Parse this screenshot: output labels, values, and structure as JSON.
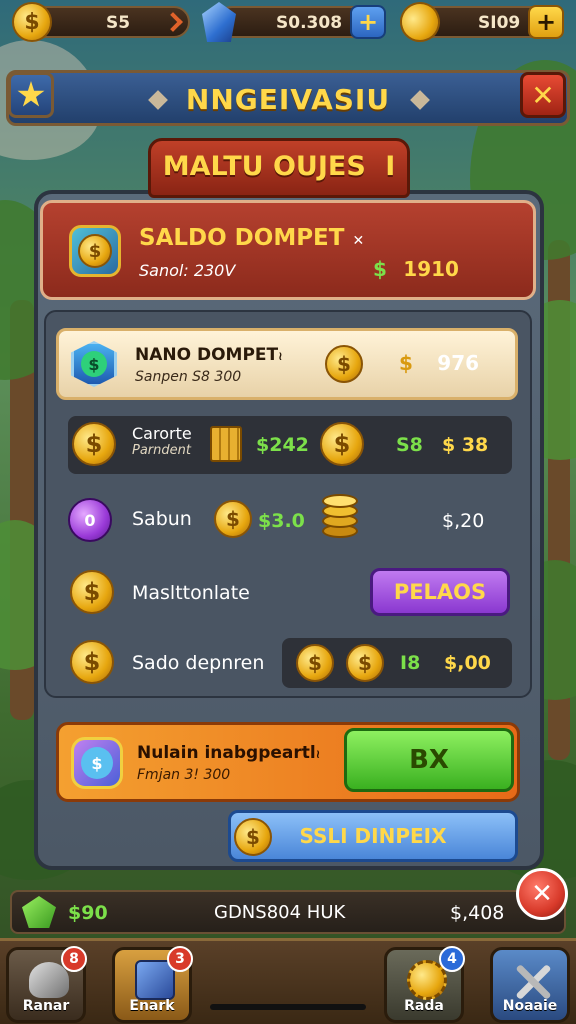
{
  "top_bar": {
    "coins_value": "S5",
    "gems_value": "S0.308",
    "gold_value": "SI09",
    "coin_glyph": "$",
    "plus_glyph": "+"
  },
  "title_banner": {
    "title": "NNGEIVASIU",
    "star_icon": "star-icon",
    "close_glyph": "✕"
  },
  "ribbon": {
    "title": "MALTU OUJES",
    "suffix": "I"
  },
  "balance_card": {
    "title": "SALDO DOMPET",
    "title_mark": "✕",
    "subtitle": "Sanol: 230V",
    "value_symbol": "$",
    "value": "1910"
  },
  "rows": [
    {
      "title": "NANO DOMPET",
      "title_mark": "≀",
      "subtitle": "Sanpen S8 300",
      "symbol": "$",
      "value": "976"
    },
    {
      "label_line1": "Carorte",
      "label_line2": "Parndent",
      "green_value": "$242",
      "green_value2": "S8",
      "gold_value": "$ 38"
    },
    {
      "label": "Sabun",
      "green_value": "$3.0",
      "value": "$,20"
    },
    {
      "label": "Maslttonlate",
      "button_label": "PELAOS"
    },
    {
      "label": "Sado depnren",
      "green_value": "I8",
      "gold_value": "$,00"
    }
  ],
  "promo": {
    "title": "Nulain inabgpeartl",
    "title_mark": "≀",
    "subtitle": "Fmjan 3! 300",
    "button_label": "BX"
  },
  "secondary_button": {
    "label": "SSLI DINPEIX"
  },
  "footer": {
    "left_value": "$90",
    "center_text": "GDNS804 HUK",
    "right_value": "$,408",
    "close_glyph": "✕"
  },
  "nav": [
    {
      "label": "Ranar",
      "badge": "8"
    },
    {
      "label": "Enark",
      "badge": "3"
    },
    {
      "label": "Rada",
      "badge": "4"
    },
    {
      "label": "Noaaie"
    }
  ],
  "colors": {
    "gold": "#ffd84a",
    "green": "#7ce04a",
    "banner_blue": "#2f5488",
    "ribbon_red": "#b5412f",
    "promo_orange": "#f08a28",
    "button_green": "#5fd43a",
    "button_purple": "#a650e0",
    "button_blue": "#6aa8f0",
    "close_red": "#d83a2a"
  }
}
